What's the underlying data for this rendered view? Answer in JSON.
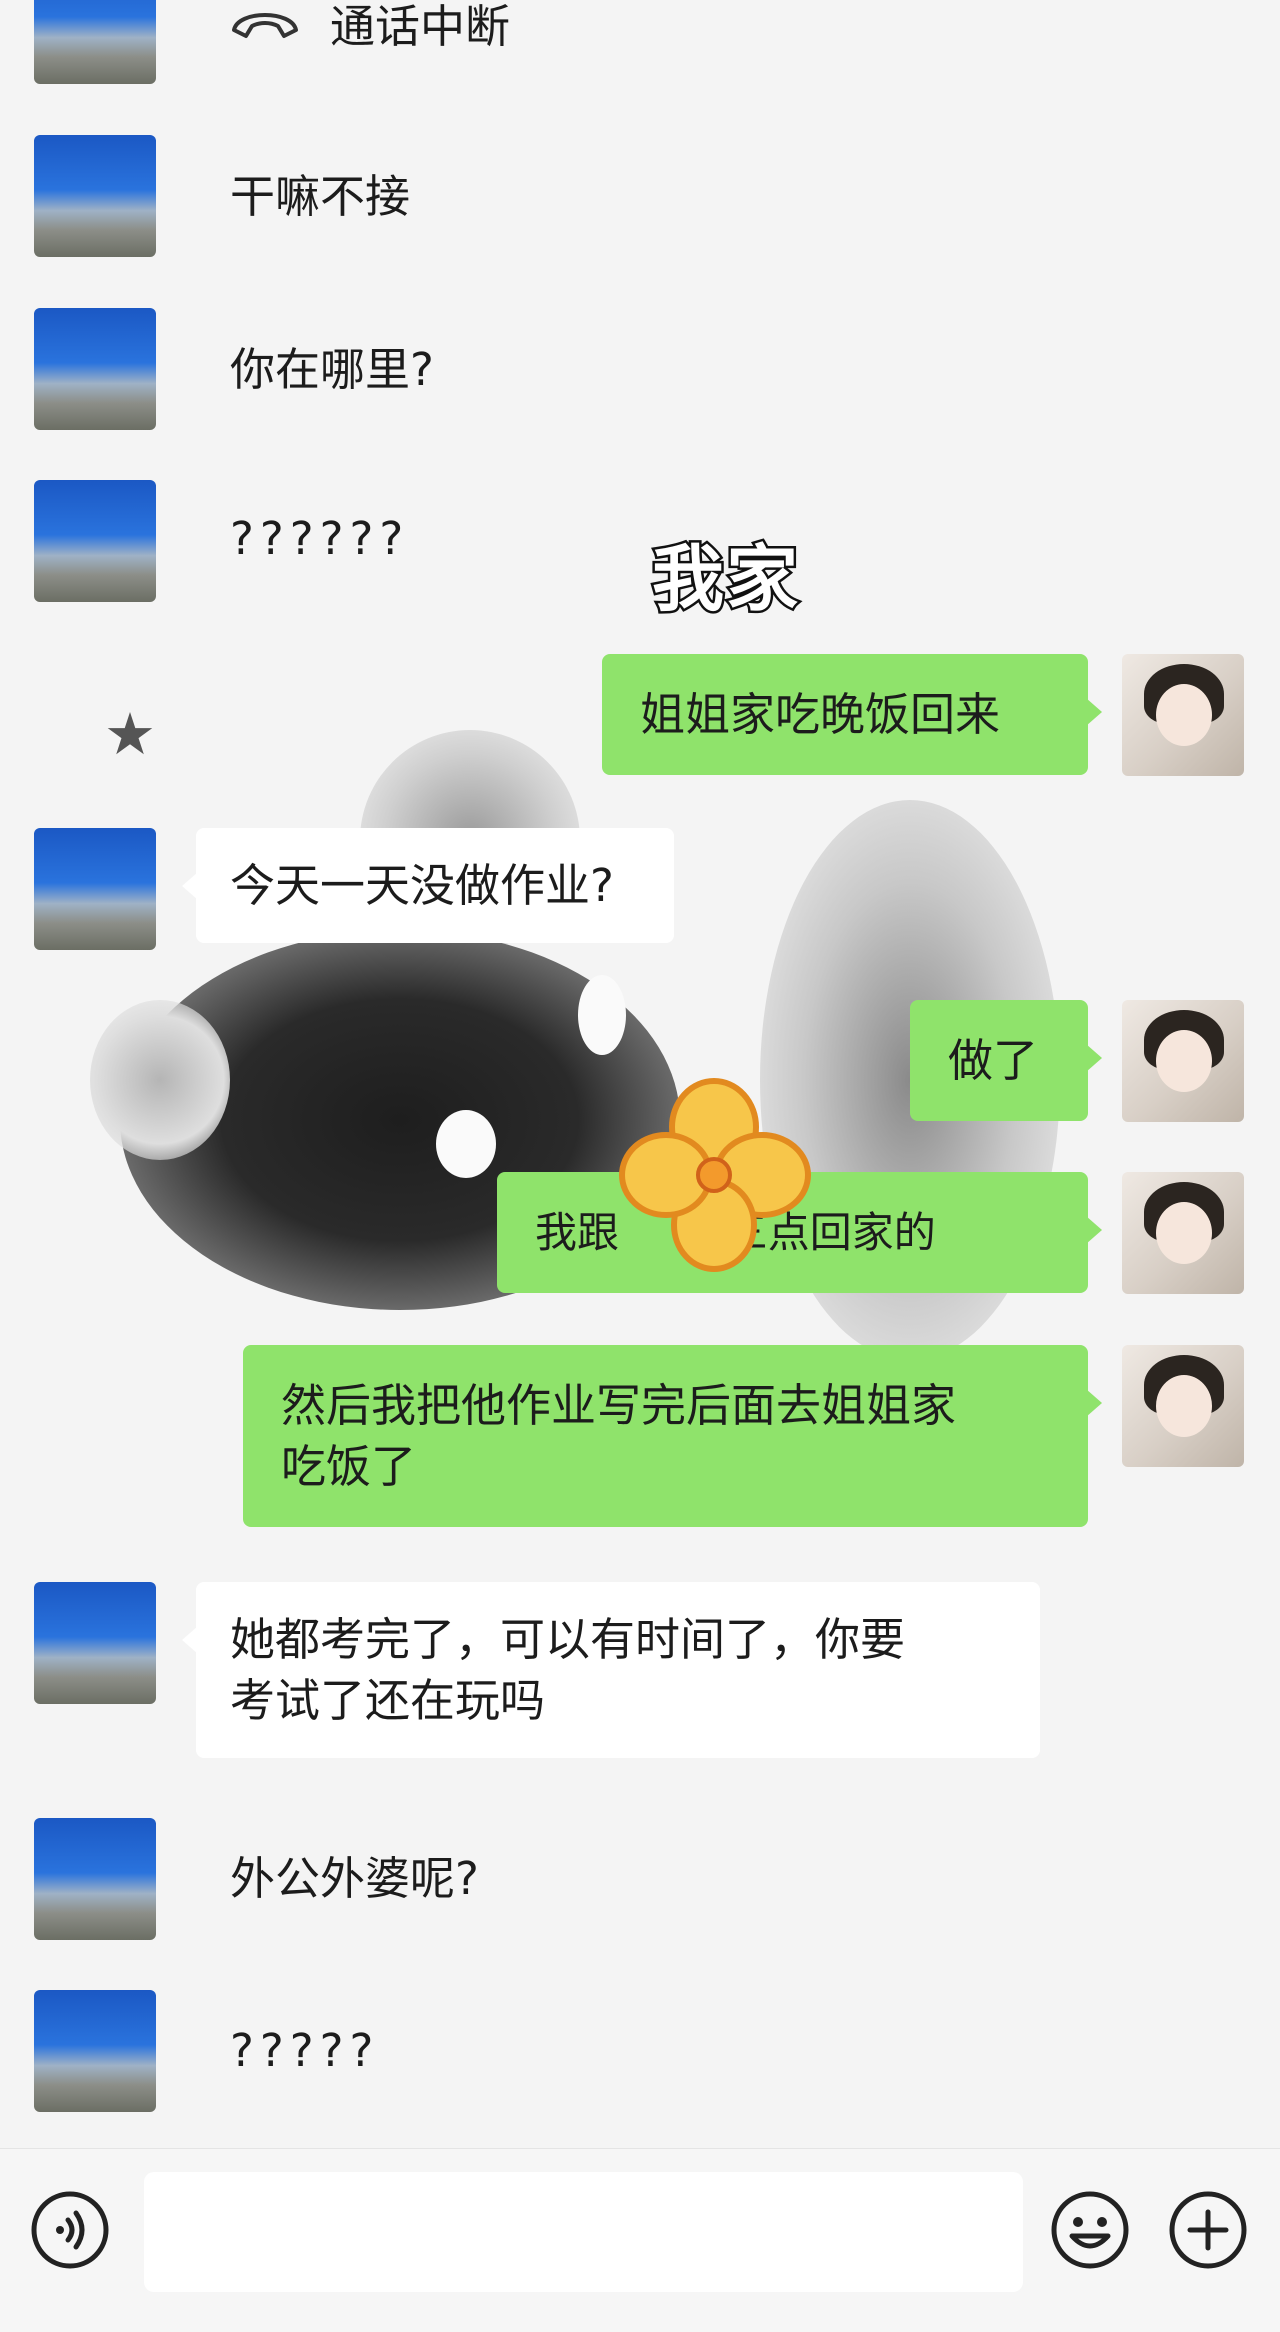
{
  "messages": [
    {
      "side": "peer",
      "text": "通话中断",
      "icon": "phone-hangup-icon"
    },
    {
      "side": "peer",
      "text": "干嘛不接"
    },
    {
      "side": "peer",
      "text": "你在哪里?"
    },
    {
      "side": "peer",
      "text": "??????"
    },
    {
      "side": "self",
      "text": "姐姐家吃晚饭回来"
    },
    {
      "side": "peer",
      "text": "今天一天没做作业?"
    },
    {
      "side": "self",
      "text": "做了"
    },
    {
      "side": "self",
      "text": "我跟        三点回家的"
    },
    {
      "side": "self",
      "text": "然后我把他作业写完后面去姐姐家\n吃饭了"
    },
    {
      "side": "peer",
      "text": "她都考完了，可以有时间了，你要\n考试了还在玩吗"
    },
    {
      "side": "peer",
      "text": "外公外婆呢?"
    },
    {
      "side": "peer",
      "text": "?????"
    }
  ],
  "overlay": {
    "sticker_text": "我家",
    "decorations": [
      "star-icon",
      "flower-sticker"
    ]
  },
  "input_bar": {
    "left_icon": "voice-icon",
    "right_icons": [
      "emoji-icon",
      "plus-icon"
    ],
    "input_value": ""
  },
  "colors": {
    "self_bubble": "#8fe36b",
    "peer_bubble": "#ffffff",
    "chat_background": "#f4f4f4"
  }
}
